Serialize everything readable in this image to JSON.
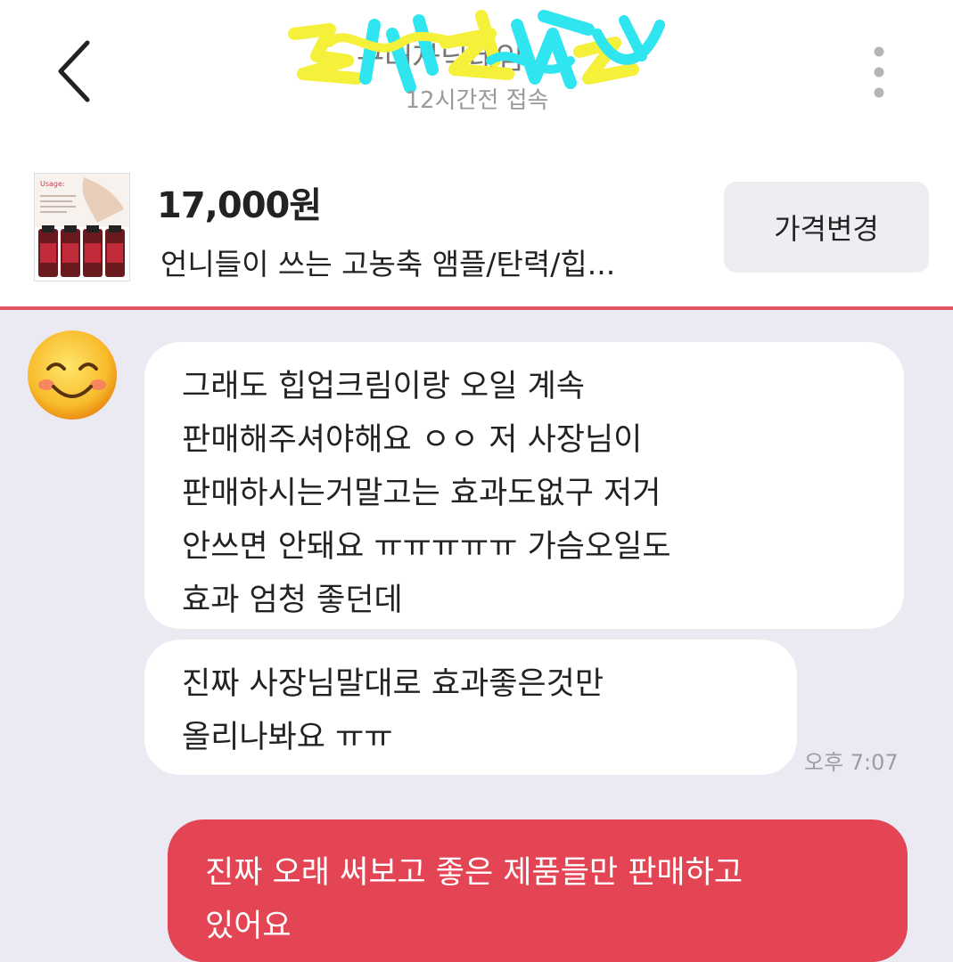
{
  "header": {
    "title": "구매자닉네임",
    "last_seen": "12시간전 접속"
  },
  "product": {
    "thumbnail_caption": "Usage:",
    "price": "17,000원",
    "name": "언니들이 쓰는 고농축 앰플/탄력/힙...",
    "change_price_label": "가격변경"
  },
  "messages": [
    {
      "from": "other",
      "lines": [
        "그래도 힙업크림이랑 오일 계속",
        "판매해주셔야해요 ㅇㅇ 저 사장님이",
        "판매하시는거말고는 효과도없구 저거",
        "안쓰면 안돼요 ㅠㅠㅠㅠㅠ 가슴오일도",
        "효과 엄청 좋던데"
      ]
    },
    {
      "from": "other",
      "lines": [
        "진짜 사장님말대로 효과좋은것만",
        "올리나봐요 ㅠㅠ"
      ],
      "time": "오후 7:07"
    },
    {
      "from": "me",
      "lines": [
        "진짜 오래 써보고 좋은 제품들만 판매하고",
        "있어요"
      ]
    }
  ],
  "colors": {
    "accent": "#e34554",
    "chat_bg": "#ebeaf3",
    "divider": "#e05665"
  }
}
